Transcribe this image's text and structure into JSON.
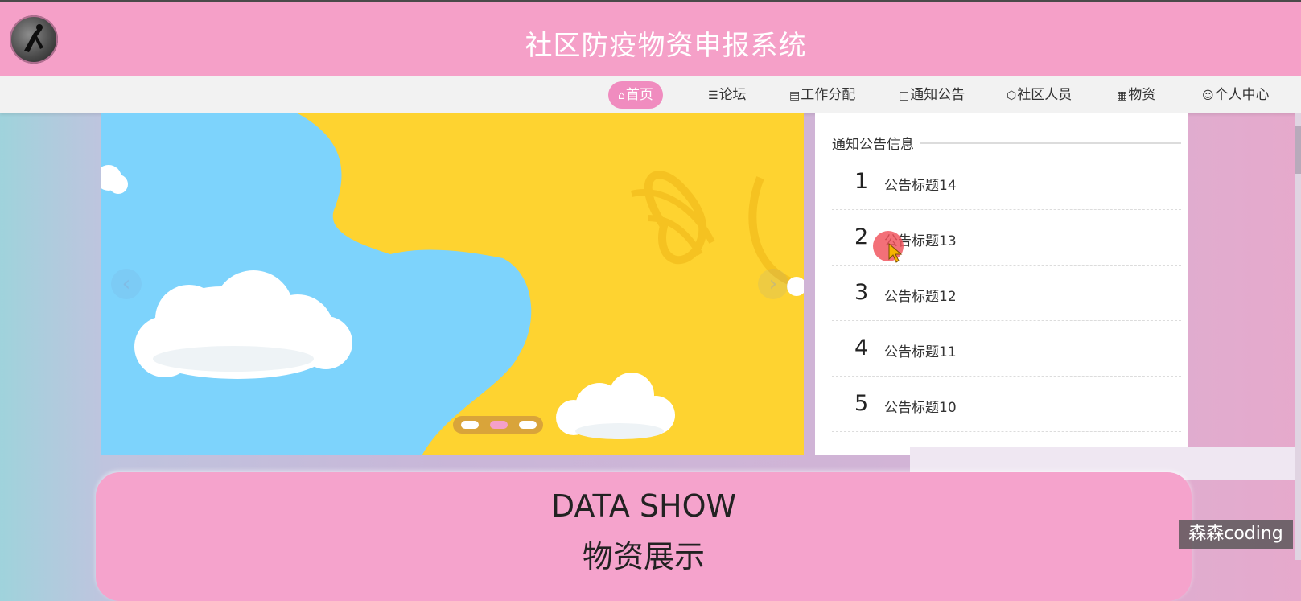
{
  "header": {
    "title": "社区防疫物资申报系统"
  },
  "nav": {
    "items": [
      {
        "label": "首页",
        "icon": "home-icon",
        "active": true
      },
      {
        "label": "论坛",
        "icon": "layers-icon",
        "active": false
      },
      {
        "label": "工作分配",
        "icon": "clipboard-icon",
        "active": false
      },
      {
        "label": "通知公告",
        "icon": "book-icon",
        "active": false
      },
      {
        "label": "社区人员",
        "icon": "cube-icon",
        "active": false
      },
      {
        "label": "物资",
        "icon": "calendar-icon",
        "active": false
      },
      {
        "label": "个人中心",
        "icon": "user-icon",
        "active": false
      }
    ]
  },
  "banner": {
    "prev_icon": "chevron-left-icon",
    "next_icon": "chevron-right-icon",
    "active_slide": 2,
    "slide_count": 3
  },
  "notice": {
    "heading": "通知公告信息",
    "items": [
      {
        "num": "1",
        "title": "公告标题14"
      },
      {
        "num": "2",
        "title": "公告标题13"
      },
      {
        "num": "3",
        "title": "公告标题12"
      },
      {
        "num": "4",
        "title": "公告标题11"
      },
      {
        "num": "5",
        "title": "公告标题10"
      }
    ]
  },
  "data_section": {
    "title": "DATA SHOW",
    "subtitle": "物资展示"
  },
  "watermark": "森森coding",
  "colors": {
    "header_bg": "#f5a0c8",
    "nav_active": "#f08cbf",
    "banner_yellow": "#fed330",
    "banner_blue": "#7dd3fc"
  }
}
